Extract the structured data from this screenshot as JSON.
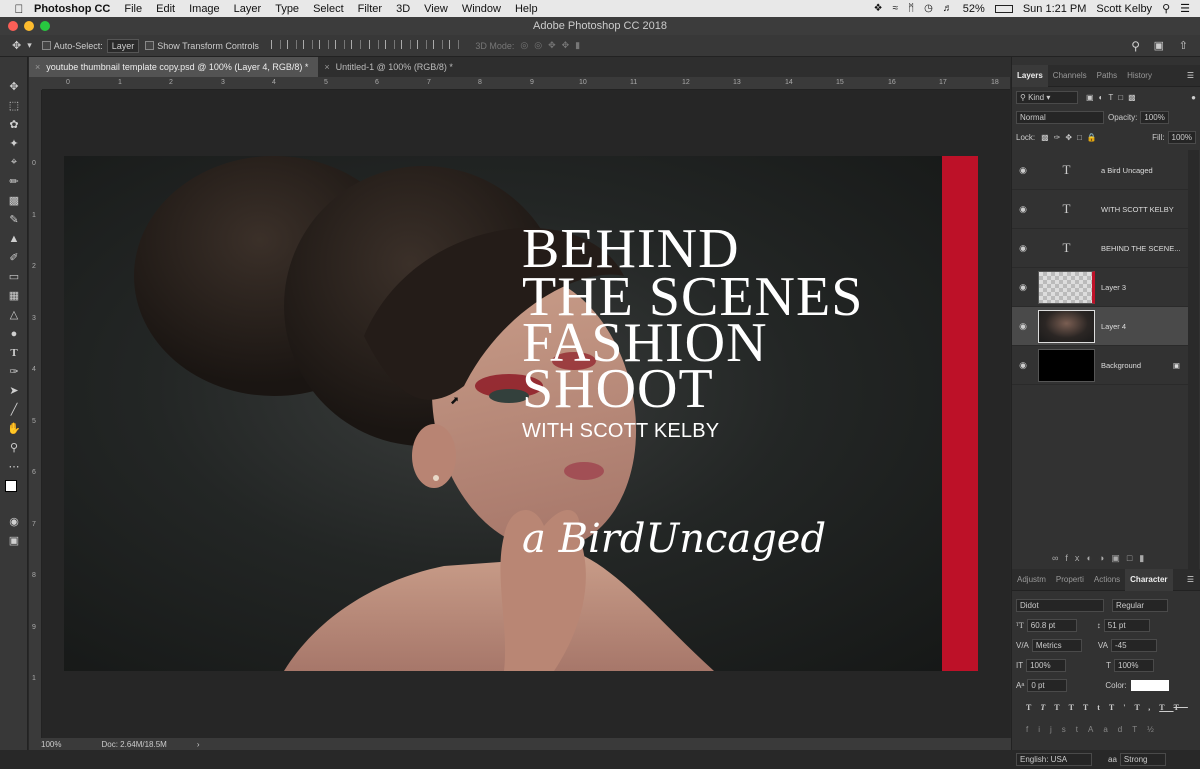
{
  "menubar": {
    "app": "Photoshop CC",
    "items": [
      "File",
      "Edit",
      "Image",
      "Layer",
      "Type",
      "Select",
      "Filter",
      "3D",
      "View",
      "Window",
      "Help"
    ],
    "battery": "52%",
    "clock": "Sun 1:21 PM",
    "user": "Scott Kelby"
  },
  "window": {
    "title": "Adobe Photoshop CC 2018"
  },
  "options": {
    "auto_select_label": "Auto-Select:",
    "auto_select_value": "Layer",
    "transform_label": "Show Transform Controls",
    "mode_3d_label": "3D Mode:"
  },
  "tabs": [
    {
      "label": "youtube thumbnail template copy.psd @ 100% (Layer 4, RGB/8) *"
    },
    {
      "label": "Untitled-1 @ 100% (RGB/8) *"
    }
  ],
  "ruler": {
    "h": [
      "0",
      "1",
      "2",
      "3",
      "4",
      "5",
      "6",
      "7",
      "8",
      "9",
      "10",
      "11",
      "12",
      "13",
      "14",
      "15",
      "16",
      "17",
      "18"
    ],
    "v": [
      "0",
      "1",
      "2",
      "3",
      "4",
      "5",
      "6",
      "7",
      "8",
      "9",
      "1"
    ]
  },
  "artwork": {
    "headline": [
      "BEHIND",
      "THE SCENES",
      "FASHION",
      "SHOOT"
    ],
    "subline": "WITH SCOTT KELBY",
    "script": "a BirdUncaged",
    "accent_color": "#bd1128"
  },
  "status": {
    "zoom": "100%",
    "doc": "Doc: 2.64M/18.5M"
  },
  "layers_panel": {
    "tabs": [
      "Layers",
      "Channels",
      "Paths",
      "History"
    ],
    "filter": "Kind",
    "blend": "Normal",
    "opacity_label": "Opacity:",
    "opacity": "100%",
    "lock_label": "Lock:",
    "fill_label": "Fill:",
    "fill": "100%",
    "layers": [
      {
        "name": "a Bird Uncaged",
        "kind": "text"
      },
      {
        "name": "WITH SCOTT KELBY",
        "kind": "text"
      },
      {
        "name": "BEHIND  THE SCENE...",
        "kind": "text"
      },
      {
        "name": "Layer 3",
        "kind": "transparent"
      },
      {
        "name": "Layer 4",
        "kind": "photo"
      },
      {
        "name": "Background",
        "kind": "black"
      }
    ]
  },
  "character_panel": {
    "tabs": [
      "Adjustm",
      "Properti",
      "Actions",
      "Character"
    ],
    "font": "Didot",
    "style": "Regular",
    "size": "60.8 pt",
    "leading": "51 pt",
    "kerning": "Metrics",
    "tracking": "-45",
    "vscale": "100%",
    "hscale": "100%",
    "baseline": "0 pt",
    "color_label": "Color:",
    "language": "English: USA",
    "aa": "Strong"
  }
}
